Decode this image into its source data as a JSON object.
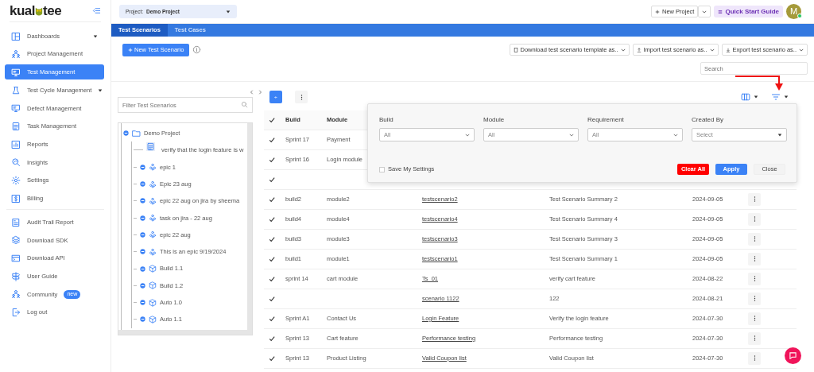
{
  "sidebar": {
    "logo": {
      "left": "kual",
      "right": "tee"
    },
    "items": [
      {
        "label": "Dashboards",
        "kind": "group",
        "selected": false
      },
      {
        "label": "Project Management",
        "kind": "link",
        "selected": false
      },
      {
        "label": "Test Management",
        "kind": "link",
        "selected": true
      },
      {
        "label": "Test Cycle Management",
        "kind": "group",
        "selected": false
      },
      {
        "label": "Defect Management",
        "kind": "link",
        "selected": false
      },
      {
        "label": "Task Management",
        "kind": "link",
        "selected": false
      },
      {
        "label": "Reports",
        "kind": "link",
        "selected": false
      },
      {
        "label": "Insights",
        "kind": "link",
        "selected": false
      },
      {
        "label": "Settings",
        "kind": "link",
        "selected": false
      },
      {
        "label": "Billing",
        "kind": "link",
        "selected": false
      }
    ],
    "footer_items": [
      {
        "label": "Audit Trail Report"
      },
      {
        "label": "Download SDK"
      },
      {
        "label": "Download API"
      },
      {
        "label": "User Guide"
      },
      {
        "label": "Community",
        "badge": "new"
      },
      {
        "label": "Log out"
      }
    ]
  },
  "topbar": {
    "project_label": "Project:",
    "project": "Demo Project",
    "new_project": "New Project",
    "quick_start": "Quick Start Guide",
    "avatar": "M",
    "online": true
  },
  "tabs": [
    {
      "label": "Test Scenarios",
      "selected": true
    },
    {
      "label": "Test Cases",
      "selected": false
    }
  ],
  "toolbar": {
    "new_button": "New Test Scenario",
    "menus": [
      "Download test scenario template as..",
      "Import test scenario as..",
      "Export test scenario as.."
    ],
    "search": {
      "placeholder": "Search"
    }
  },
  "tree_panel": {
    "filter": {
      "placeholder": "Filter Test Scenarios"
    },
    "root": {
      "label": "Demo Project",
      "children": [
        {
          "label": "verify that the login feature is w",
          "kind": "scenario"
        },
        {
          "label": "epic 1",
          "kind": "epic"
        },
        {
          "label": "Epic 23 aug",
          "kind": "epic"
        },
        {
          "label": "epic 22 aug on jira by sheema",
          "kind": "epic"
        },
        {
          "label": "task on jira - 22 aug",
          "kind": "epic"
        },
        {
          "label": "epic 22 aug",
          "kind": "epic"
        },
        {
          "label": "This is an epic 9/19/2024",
          "kind": "epic"
        },
        {
          "label": "Build 1.1",
          "kind": "build"
        },
        {
          "label": "Build 1.2",
          "kind": "build"
        },
        {
          "label": "Auto 1.0",
          "kind": "build"
        },
        {
          "label": "Auto 1.1",
          "kind": "build"
        }
      ]
    }
  },
  "table": {
    "columns": [
      "Build",
      "Module"
    ],
    "header_checked": true,
    "rows": [
      {
        "checked": true,
        "build": "Sprint 17",
        "module": "Payment"
      },
      {
        "checked": true,
        "build": "Sprint 16",
        "module": "Login module"
      },
      {
        "checked": true
      },
      {
        "checked": true,
        "build": "build2",
        "module": "module2",
        "scenario": "testscenario2",
        "summary": "Test Scenario Summary 2",
        "date": "2024-09-05"
      },
      {
        "checked": true,
        "build": "build4",
        "module": "module4",
        "scenario": "testscenario4",
        "summary": "Test Scenario Summary 4",
        "date": "2024-09-05"
      },
      {
        "checked": true,
        "build": "build3",
        "module": "module3",
        "scenario": "testscenario3",
        "summary": "Test Scenario Summary 3",
        "date": "2024-09-05"
      },
      {
        "checked": true,
        "build": "build1",
        "module": "module1",
        "scenario": "testscenario1",
        "summary": "Test Scenario Summary 1",
        "date": "2024-09-05"
      },
      {
        "checked": true,
        "build": "sprint 14",
        "module": "cart module",
        "scenario": "Ts_01",
        "summary": "verify cart feature",
        "date": "2024-08-22"
      },
      {
        "checked": true,
        "scenario": "scenario 1122",
        "summary": "122",
        "date": "2024-08-21"
      },
      {
        "checked": true,
        "build": "Sprint A1",
        "module": "Contact Us",
        "scenario": "Login Feature",
        "summary": "Verify the login feature",
        "date": "2024-07-30"
      },
      {
        "checked": true,
        "build": "Sprint 13",
        "module": "Cart feature",
        "scenario": "Performance testing",
        "summary": "Performance testing",
        "date": "2024-07-30"
      },
      {
        "checked": true,
        "build": "Sprint 13",
        "module": "Product Listing",
        "scenario": "Valid Coupon list",
        "summary": "Valid Coupon list",
        "date": "2024-07-30"
      }
    ]
  },
  "filter_popover": {
    "fields": [
      {
        "label": "Build",
        "value": "All"
      },
      {
        "label": "Module",
        "value": "All"
      },
      {
        "label": "Requirement",
        "value": "All"
      },
      {
        "label": "Created By",
        "placeholder": "Select"
      }
    ],
    "save_settings": {
      "label": "Save My Settings",
      "checked": false
    },
    "buttons": [
      {
        "label": "Clear All",
        "kind": "danger"
      },
      {
        "label": "Apply",
        "kind": "primary"
      },
      {
        "label": "Close",
        "kind": "plain"
      }
    ]
  }
}
